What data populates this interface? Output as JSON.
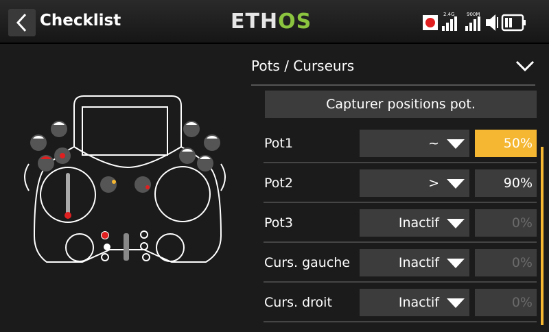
{
  "header": {
    "title": "Checklist",
    "logo_part1": "ETH",
    "logo_part2": "OS",
    "signal_24": "2.4G",
    "signal_900": "900M"
  },
  "section": {
    "title": "Pots / Curseurs"
  },
  "capture_button": "Capturer positions pot.",
  "rows": [
    {
      "label": "Pot1",
      "mode": "~",
      "value": "50%",
      "active": true
    },
    {
      "label": "Pot2",
      "mode": ">",
      "value": "90%",
      "active": false
    },
    {
      "label": "Pot3",
      "mode": "Inactif",
      "value": "0%",
      "active": false
    },
    {
      "label": "Curs. gauche",
      "mode": "Inactif",
      "value": "0%",
      "active": false
    },
    {
      "label": "Curs. droit",
      "mode": "Inactif",
      "value": "0%",
      "active": false
    }
  ],
  "colors": {
    "accent": "#f5b731",
    "logo_green": "#8bc43f",
    "record_red": "#e02020"
  }
}
